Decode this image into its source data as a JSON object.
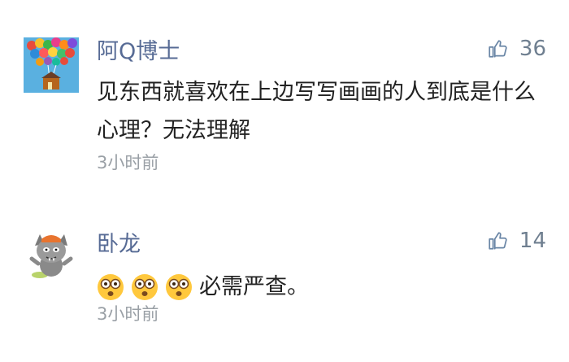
{
  "comments": [
    {
      "username": "阿Q博士",
      "likes": "36",
      "content": "见东西就喜欢在上边写写画画的人到底是什么心理？无法理解",
      "time": "3小时前",
      "avatar": "balloon-house-avatar"
    },
    {
      "username": "卧龙",
      "likes": "14",
      "content": "必需严查。",
      "emojis": [
        "shocked-face-emoji",
        "shocked-face-emoji",
        "shocked-face-emoji"
      ],
      "time": "3小时前",
      "avatar": "cartoon-wolf-avatar"
    }
  ],
  "colors": {
    "username": "#576b95",
    "text": "#222222",
    "meta": "#9aa0a6",
    "like_icon": "#6a86a6"
  }
}
